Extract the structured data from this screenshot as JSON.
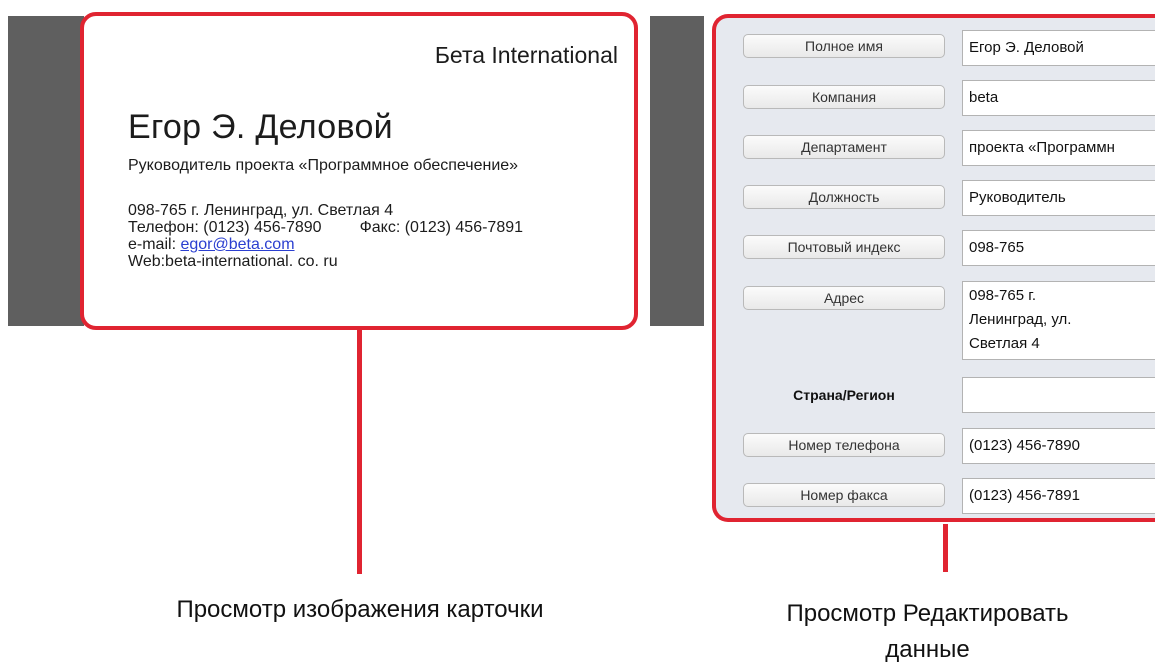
{
  "card_preview": {
    "company": "Бета International",
    "name": "Егор Э. Деловой",
    "title": "Руководитель проекта «Программное обеспечение»",
    "address_line": "098-765 г. Ленинград, ул. Светлая 4",
    "phone_line": "Телефон: (0123) 456-7890",
    "fax_line": "Факс: (0123) 456-7891",
    "email_prefix": "e-mail: ",
    "email": "egor@beta.com",
    "web_line": "Web:beta-international. co. ru"
  },
  "captions": {
    "card_view": "Просмотр изображения карточки",
    "edit_view_line1": "Просмотр Редактировать",
    "edit_view_line2": "данные"
  },
  "fields": [
    {
      "label": "Полное имя",
      "value": "Егор Э. Деловой"
    },
    {
      "label": "Компания",
      "value": "beta"
    },
    {
      "label": "Департамент",
      "value": "проекта «Программн"
    },
    {
      "label": "Должность",
      "value": "Руководитель"
    },
    {
      "label": "Почтовый индекс",
      "value": "098-765"
    },
    {
      "label": "Адрес",
      "value_lines": [
        "098-765 г.",
        "Ленинград, ул.",
        "Светлая 4"
      ]
    },
    {
      "label": "Страна/Регион",
      "value": ""
    },
    {
      "label": "Номер телефона",
      "value": "(0123) 456-7890"
    },
    {
      "label": "Номер факса",
      "value": "(0123) 456-7891"
    }
  ],
  "colors": {
    "highlight_frame": "#e02431",
    "panel_background": "#e6e9ef",
    "card_backdrop": "#5f5f5f",
    "link": "#2b3fd0"
  }
}
